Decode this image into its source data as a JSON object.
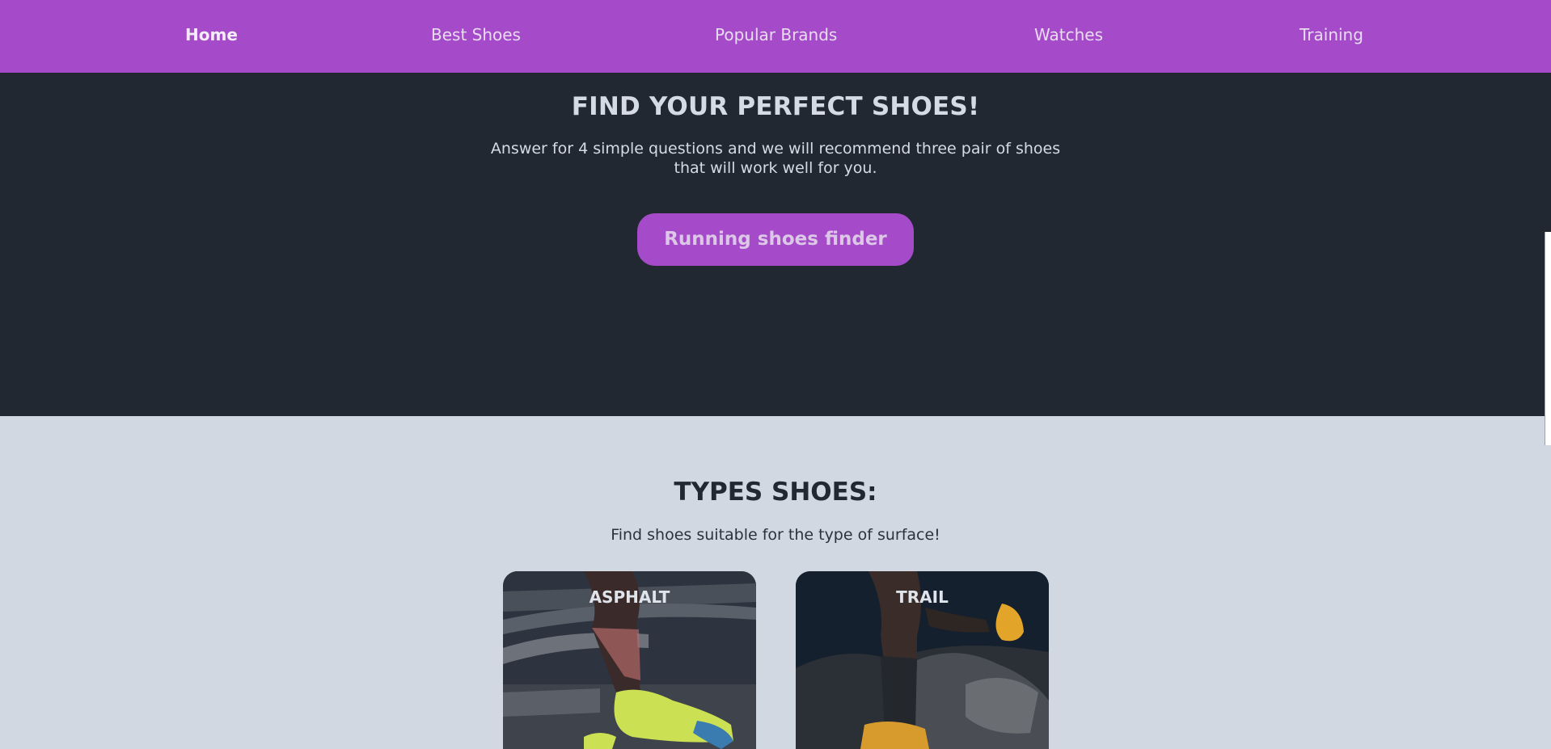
{
  "nav": {
    "items": [
      {
        "label": "Home",
        "active": true
      },
      {
        "label": "Best Shoes",
        "active": false
      },
      {
        "label": "Popular Brands",
        "active": false
      },
      {
        "label": "Watches",
        "active": false
      },
      {
        "label": "Training",
        "active": false
      }
    ]
  },
  "hero": {
    "title": "FIND YOUR PERFECT SHOES!",
    "subtitle_line1": "Answer for 4 simple questions and we will recommend three pair of shoes",
    "subtitle_line2": "that will work well for you.",
    "button_label": "Running shoes finder"
  },
  "types": {
    "title": "TYPES SHOES:",
    "subtitle": "Find shoes suitable for the type of surface!",
    "cards": [
      {
        "label": "ASPHALT",
        "image": "runner-on-asphalt-photo"
      },
      {
        "label": "TRAIL",
        "image": "runner-on-trail-photo"
      }
    ]
  },
  "colors": {
    "accent": "#a54bca",
    "dark": "#222831",
    "light": "#d1d8e1"
  }
}
